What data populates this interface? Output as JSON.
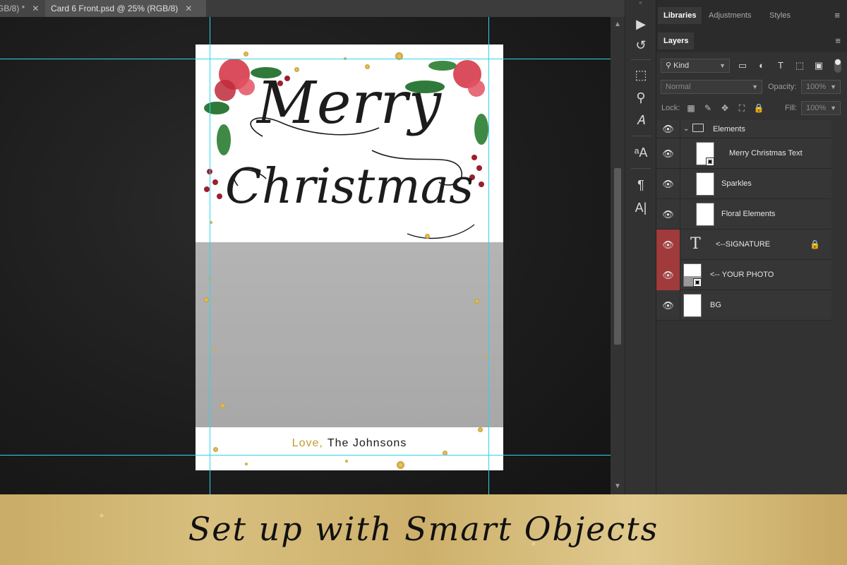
{
  "tabs": [
    {
      "label": "GB/8) *"
    },
    {
      "label": "Card 6 Front.psd @ 25% (RGB/8)"
    }
  ],
  "card": {
    "title_line1": "Merry",
    "title_line2": "Christmas",
    "signature_love": "Love,",
    "signature_name": "The Johnsons"
  },
  "panels": {
    "top_tabs": [
      "Libraries",
      "Adjustments",
      "Styles"
    ],
    "layers_tab": "Layers",
    "filter_kind": "Kind",
    "blend_mode": "Normal",
    "opacity_label": "Opacity:",
    "opacity_value": "100%",
    "lock_label": "Lock:",
    "fill_label": "Fill:",
    "fill_value": "100%"
  },
  "layers": [
    {
      "name": "Elements",
      "type": "group"
    },
    {
      "name": "Merry Christmas Text",
      "type": "smart"
    },
    {
      "name": "Sparkles",
      "type": "smart"
    },
    {
      "name": "Floral Elements",
      "type": "smart"
    },
    {
      "name": "<--SIGNATURE",
      "type": "text"
    },
    {
      "name": "<-- YOUR PHOTO",
      "type": "smart"
    },
    {
      "name": "BG",
      "type": "pixel"
    }
  ],
  "banner": {
    "text": "Set up with Smart Objects"
  },
  "colors": {
    "guide": "#2fd4ea",
    "layer_highlight": "#a13a3a",
    "gold": "#c9ac66"
  },
  "icons": {
    "eye": "visibility-eye-icon",
    "lock": "lock-icon",
    "menu": "hamburger-menu-icon"
  }
}
